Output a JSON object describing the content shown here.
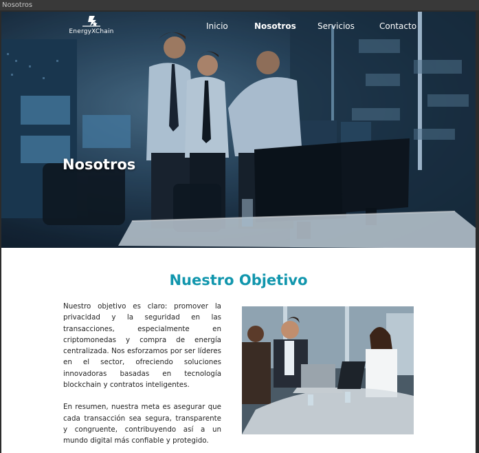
{
  "window": {
    "title": "Nosotros"
  },
  "brand": {
    "name": "EnergyXChain",
    "logo_icon": "energy-bolt-star-icon"
  },
  "nav": {
    "items": [
      {
        "label": "Inicio",
        "active": false
      },
      {
        "label": "Nosotros",
        "active": true
      },
      {
        "label": "Servicios",
        "active": false
      },
      {
        "label": "Contacto",
        "active": false
      }
    ]
  },
  "hero": {
    "title": "Nosotros",
    "image": "control-room-team-photo"
  },
  "objective": {
    "title": "Nuestro Objetivo",
    "paragraphs": [
      "Nuestro objetivo es claro: promover la privacidad y la seguridad en las transacciones, especialmente en criptomonedas y compra de energía centralizada. Nos esforzamos por ser líderes en el sector, ofreciendo soluciones innovadoras basadas en tecnología blockchain y contratos inteligentes.",
      "En resumen, nuestra meta es asegurar que cada transacción sea segura, transparente y congruente, contribuyendo así a un mundo digital más confiable y protegido."
    ],
    "image": "office-meeting-photo"
  },
  "colors": {
    "accent": "#1196ad",
    "text": "#222222",
    "nav_text": "#ffffff"
  }
}
